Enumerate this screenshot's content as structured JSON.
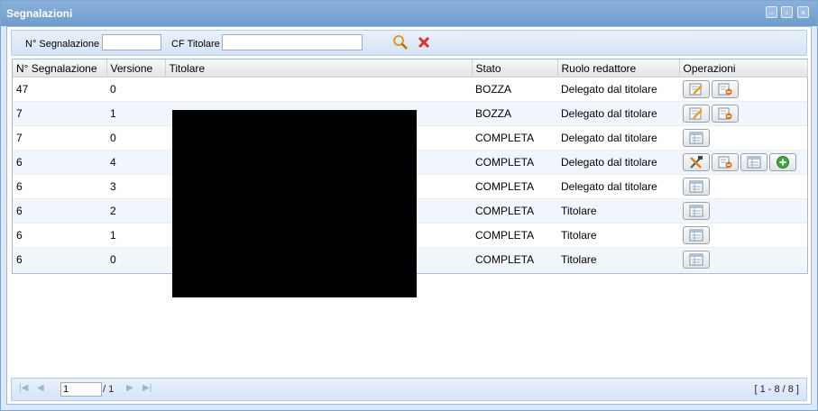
{
  "window": {
    "title": "Segnalazioni"
  },
  "toolbar": {
    "num_label": "N° Segnalazione",
    "num_value": "",
    "cf_label": "CF Titolare",
    "cf_value": ""
  },
  "columns": [
    "N° Segnalazione",
    "Versione",
    "Titolare",
    "Stato",
    "Ruolo redattore",
    "Operazioni"
  ],
  "rows": [
    {
      "num": "47",
      "ver": "0",
      "titolare": "",
      "stato": "BOZZA",
      "ruolo": "Delegato dal titolare",
      "ops": [
        "edit",
        "delete"
      ]
    },
    {
      "num": "7",
      "ver": "1",
      "titolare": "",
      "stato": "BOZZA",
      "ruolo": "Delegato dal titolare",
      "ops": [
        "edit",
        "delete"
      ]
    },
    {
      "num": "7",
      "ver": "0",
      "titolare": "",
      "stato": "COMPLETA",
      "ruolo": "Delegato dal titolare",
      "ops": [
        "view"
      ]
    },
    {
      "num": "6",
      "ver": "4",
      "titolare": "",
      "stato": "COMPLETA",
      "ruolo": "Delegato dal titolare",
      "ops": [
        "tools",
        "delete",
        "view",
        "add"
      ]
    },
    {
      "num": "6",
      "ver": "3",
      "titolare": "",
      "stato": "COMPLETA",
      "ruolo": "Delegato dal titolare",
      "ops": [
        "view"
      ]
    },
    {
      "num": "6",
      "ver": "2",
      "titolare": "",
      "stato": "COMPLETA",
      "ruolo": "Titolare",
      "ops": [
        "view"
      ]
    },
    {
      "num": "6",
      "ver": "1",
      "titolare": "",
      "stato": "COMPLETA",
      "ruolo": "Titolare",
      "ops": [
        "view"
      ]
    },
    {
      "num": "6",
      "ver": "0",
      "titolare": "",
      "stato": "COMPLETA",
      "ruolo": "Titolare",
      "ops": [
        "view"
      ]
    }
  ],
  "pager": {
    "page_value": "1",
    "total_pages": "/ 1",
    "range": "[ 1 - 8 / 8 ]"
  },
  "colors": {
    "header_blue": "#7ca6cf",
    "accent_red": "#e03030",
    "search_orange": "#e09a20"
  }
}
